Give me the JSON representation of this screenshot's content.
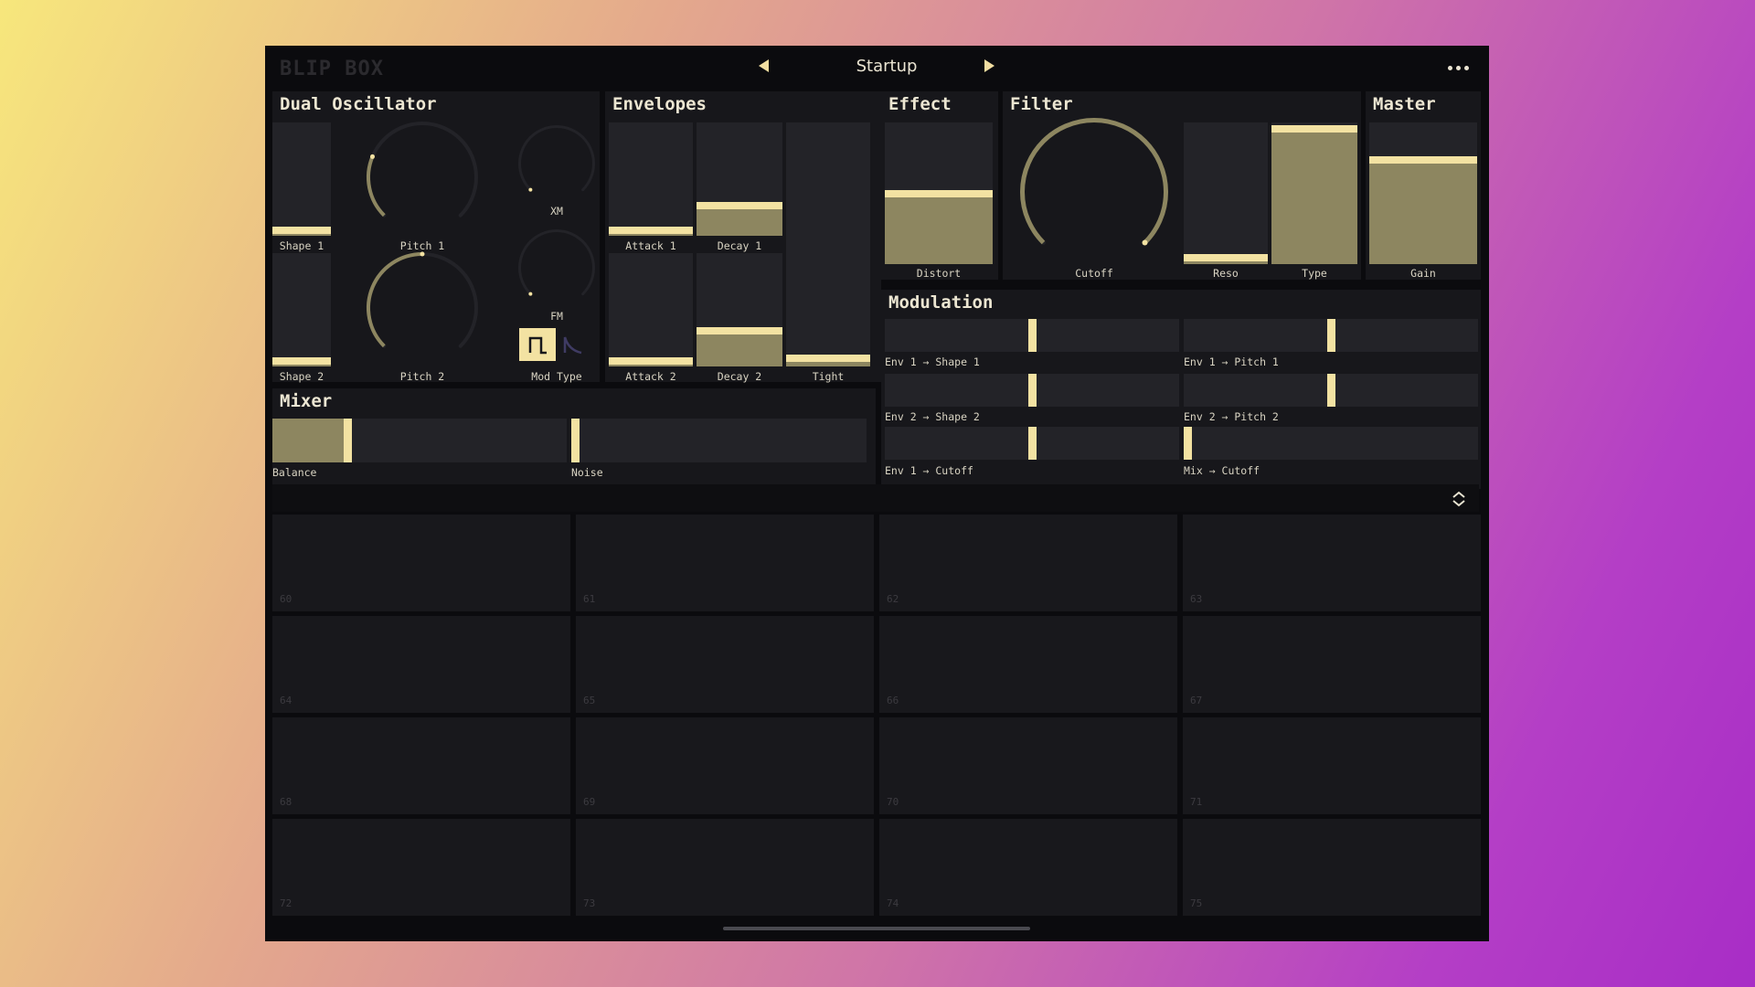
{
  "app": {
    "title": "BLIP BOX"
  },
  "header": {
    "preset": "Startup",
    "prev_icon": "caret-left-icon",
    "next_icon": "caret-right-icon",
    "menu_icon": "more-horizontal-icon"
  },
  "colors": {
    "accent": "#f3e2a2",
    "fill": "#8d8660",
    "track": "#232328",
    "panel": "#17171b",
    "background": "#0b0b0e"
  },
  "dual_oscillator": {
    "title": "Dual Oscillator",
    "shape1": {
      "label": "Shape 1",
      "value": 0.02
    },
    "shape2": {
      "label": "Shape 2",
      "value": 0.02
    },
    "pitch1": {
      "label": "Pitch 1",
      "value": 0.25
    },
    "pitch2": {
      "label": "Pitch 2",
      "value": 0.5
    },
    "xm": {
      "label": "XM",
      "value": 0.0
    },
    "fm": {
      "label": "FM",
      "value": 0.0
    },
    "mod_type": {
      "label": "Mod Type",
      "options": [
        "square-wave-icon",
        "decay-curve-icon"
      ],
      "selected": 0
    }
  },
  "envelopes": {
    "title": "Envelopes",
    "attack1": {
      "label": "Attack 1",
      "value": 0.02
    },
    "decay1": {
      "label": "Decay 1",
      "value": 0.25
    },
    "attack2": {
      "label": "Attack 2",
      "value": 0.02
    },
    "decay2": {
      "label": "Decay 2",
      "value": 0.3
    },
    "tight": {
      "label": "Tight",
      "value": 0.02
    }
  },
  "effect": {
    "title": "Effect",
    "distort": {
      "label": "Distort",
      "value": 0.5
    }
  },
  "filter": {
    "title": "Filter",
    "cutoff": {
      "label": "Cutoff",
      "value": 1.0
    },
    "reso": {
      "label": "Reso",
      "value": 0.02
    },
    "type": {
      "label": "Type",
      "value": 0.98
    }
  },
  "master": {
    "title": "Master",
    "gain": {
      "label": "Gain",
      "value": 0.75
    }
  },
  "modulation": {
    "title": "Modulation",
    "routes": [
      {
        "label": "Env 1 → Shape 1",
        "value": 0.5
      },
      {
        "label": "Env 1 → Pitch 1",
        "value": 0.5
      },
      {
        "label": "Env 2 → Shape 2",
        "value": 0.5
      },
      {
        "label": "Env 2 → Pitch 2",
        "value": 0.5
      },
      {
        "label": "Env 1 → Cutoff",
        "value": 0.5
      },
      {
        "label": "Mix → Cutoff",
        "value": 0.0
      }
    ]
  },
  "mixer": {
    "title": "Mixer",
    "balance": {
      "label": "Balance",
      "value": 0.25
    },
    "noise": {
      "label": "Noise",
      "value": 0.0
    }
  },
  "pads": {
    "collapse_icon": "chevron-up-down-icon",
    "notes": [
      "60",
      "61",
      "62",
      "63",
      "64",
      "65",
      "66",
      "67",
      "68",
      "69",
      "70",
      "71",
      "72",
      "73",
      "74",
      "75"
    ]
  }
}
